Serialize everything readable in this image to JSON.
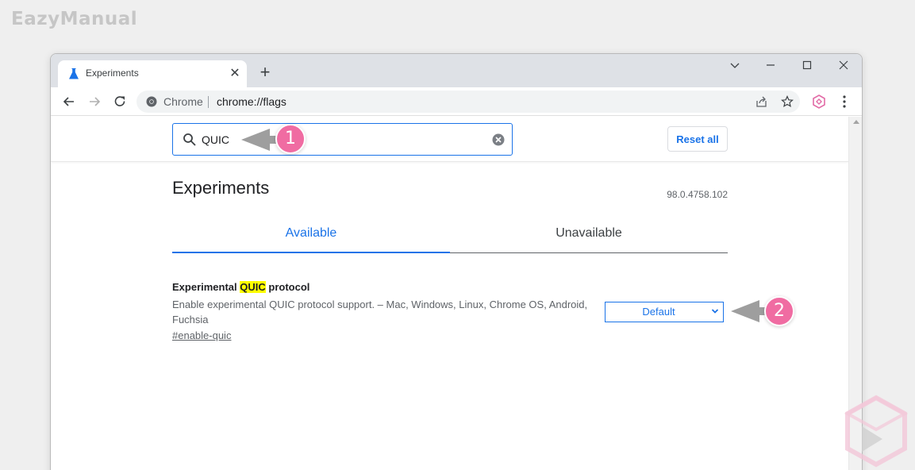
{
  "watermark": "EazyManual",
  "browser": {
    "tab_title": "Experiments",
    "omnibox_chrome_label": "Chrome",
    "url": "chrome://flags"
  },
  "flags_page": {
    "search": {
      "value": "QUIC"
    },
    "reset_all_label": "Reset all",
    "title": "Experiments",
    "version": "98.0.4758.102",
    "tabs": [
      {
        "label": "Available",
        "active": true
      },
      {
        "label": "Unavailable",
        "active": false
      }
    ],
    "experiment": {
      "name_prefix": "Experimental ",
      "name_highlight": "QUIC",
      "name_suffix": " protocol",
      "description": "Enable experimental QUIC protocol support. – Mac, Windows, Linux, Chrome OS, Android, Fuchsia",
      "link": "#enable-quic",
      "select_value": "Default"
    }
  },
  "callouts": [
    {
      "number": "1"
    },
    {
      "number": "2"
    }
  ],
  "colors": {
    "accent": "#1a73e8",
    "highlight": "#ffff00",
    "callout": "#f06ca2",
    "arrow": "#9e9e9e"
  }
}
